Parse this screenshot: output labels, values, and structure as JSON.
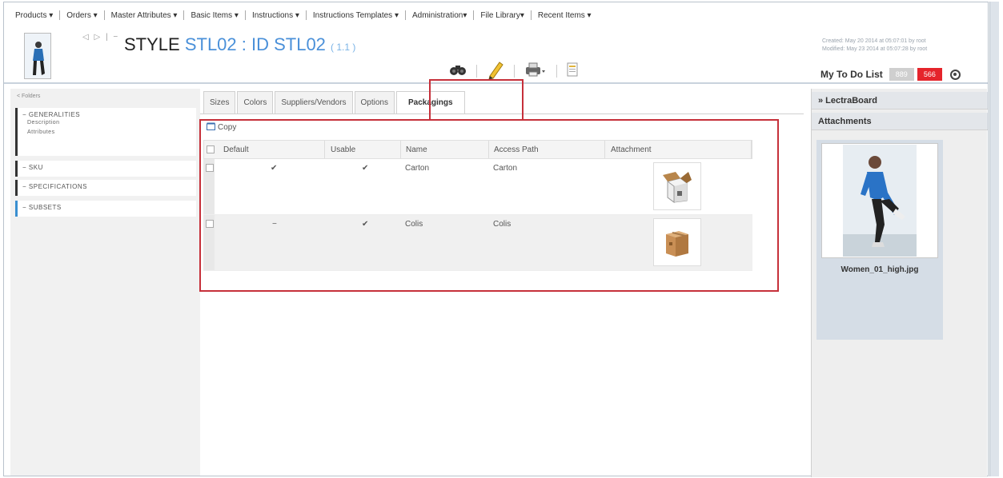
{
  "menu": [
    "Products ▾",
    "Orders ▾",
    "Master Attributes ▾",
    "Basic Items ▾",
    "Instructions ▾",
    "Instructions Templates ▾",
    "Administration▾",
    "File Library▾",
    "Recent Items ▾"
  ],
  "header": {
    "nav": "◁ ▷ |  −",
    "title_prefix": "STYLE",
    "title_code": "STL02 : ID STL02",
    "title_version": "( 1.1 )",
    "meta_created": "Created: May 20 2014 at 05:07:01 by root",
    "meta_modified": "Modified: May 23 2014 at 05:07:28 by root"
  },
  "todo": {
    "label": "My To Do List",
    "count_a": "889",
    "count_b": "566"
  },
  "left": {
    "top_label": "< Folders",
    "groups": [
      {
        "title": "− GENERALITIES",
        "subs": [
          "Description",
          "Attributes"
        ]
      },
      {
        "title": "− SKU"
      },
      {
        "title": "− SPECIFICATIONS"
      },
      {
        "title": "− SUBSETS"
      }
    ]
  },
  "tabs": [
    "Sizes",
    "Colors",
    "Suppliers/Vendors",
    "Options",
    "Packagings"
  ],
  "active_tab": "Packagings",
  "copy_label": "Copy",
  "grid": {
    "columns": [
      "Default",
      "Usable",
      "Name",
      "Access Path",
      "Attachment"
    ],
    "rows": [
      {
        "default": "✔",
        "usable": "✔",
        "name": "Carton",
        "path": "Carton",
        "attachment": "open-box-icon"
      },
      {
        "default": "−",
        "usable": "✔",
        "name": "Colis",
        "path": "Colis",
        "attachment": "closed-box-icon"
      }
    ]
  },
  "right": {
    "lectra": "» LectraBoard",
    "attachments": "Attachments",
    "filename": "Women_01_high.jpg"
  },
  "colors": {
    "accent": "#4a90d9",
    "highlight": "#c6303a",
    "badge_red": "#e5242b"
  }
}
